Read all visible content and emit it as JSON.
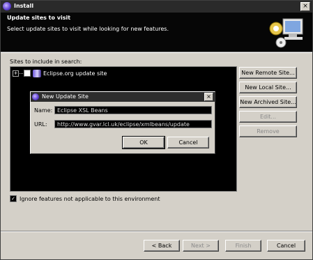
{
  "window": {
    "title": "Install",
    "close_glyph": "×"
  },
  "banner": {
    "heading": "Update sites to visit",
    "description": "Select update sites to visit while looking for new features."
  },
  "sites": {
    "label": "Sites to include in search:",
    "items": [
      {
        "label": "Eclipse.org update site",
        "checked": false
      }
    ]
  },
  "side_buttons": {
    "new_remote": "New Remote Site...",
    "new_local": "New Local Site...",
    "new_archived": "New Archived Site...",
    "edit": "Edit...",
    "remove": "Remove"
  },
  "dialog": {
    "title": "New Update Site",
    "name_label": "Name:",
    "name_value": "Eclipse XSL Beans",
    "url_label": "URL:",
    "url_value": "http://www.gvar.lcl.uk/eclipse/xmlbeans/update",
    "ok": "OK",
    "cancel": "Cancel",
    "close_glyph": "×"
  },
  "ignore_option": {
    "label": "Ignore features not applicable to this environment",
    "checked": true
  },
  "footer": {
    "back": "< Back",
    "next": "Next >",
    "finish": "Finish",
    "cancel": "Cancel"
  }
}
